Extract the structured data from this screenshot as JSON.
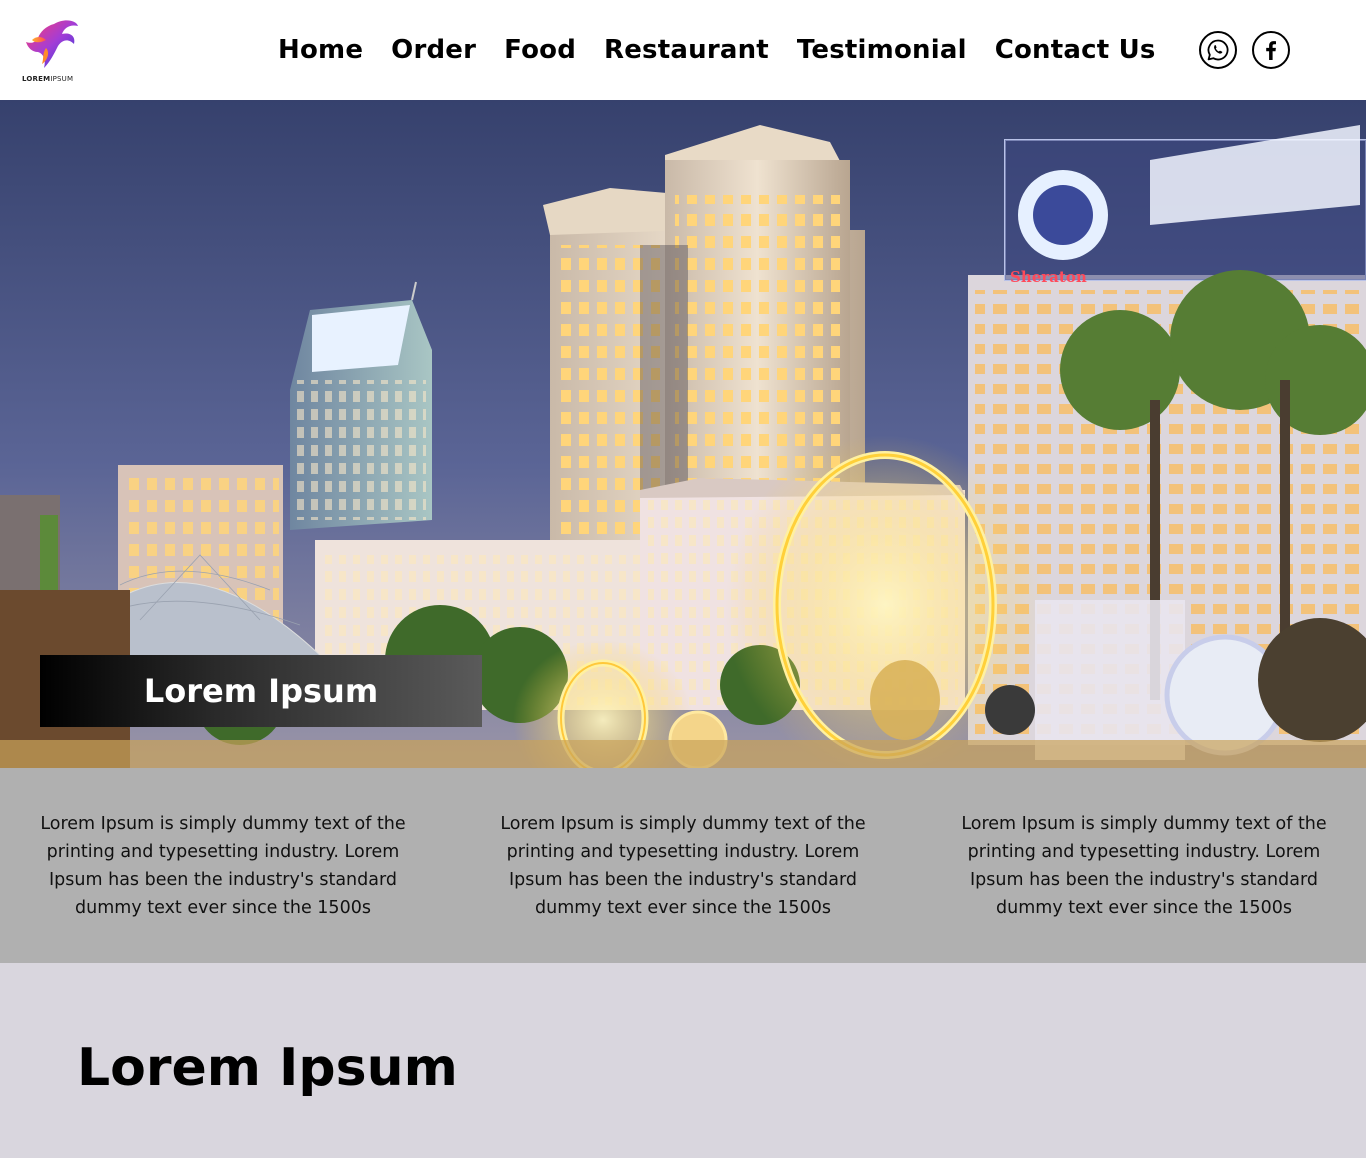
{
  "brand": {
    "logo_text_bold": "LOREM",
    "logo_text_light": "IPSUM"
  },
  "nav": [
    {
      "label": "Home"
    },
    {
      "label": "Order"
    },
    {
      "label": "Food"
    },
    {
      "label": "Restaurant"
    },
    {
      "label": "Testimonial"
    },
    {
      "label": "Contact Us"
    }
  ],
  "social": [
    {
      "icon": "whatsapp-icon"
    },
    {
      "icon": "facebook-icon"
    }
  ],
  "hero": {
    "label": "Lorem Ipsum",
    "sign_text": "Sheraton"
  },
  "features": [
    {
      "text": "Lorem Ipsum is simply dummy text of the printing and typesetting industry. Lorem Ipsum has been the industry's standard dummy text ever since the 1500s"
    },
    {
      "text": "Lorem Ipsum is simply dummy text of the printing and typesetting industry. Lorem Ipsum has been the industry's standard dummy text ever since the 1500s"
    },
    {
      "text": "Lorem Ipsum is simply dummy text of the printing and typesetting industry. Lorem Ipsum has been the industry's standard dummy text ever since the 1500s"
    }
  ],
  "section": {
    "title": "Lorem Ipsum"
  },
  "colors": {
    "header_bg": "#ffffff",
    "features_bg": "#b0b0b0",
    "section_bg": "#d9d6de",
    "label_gradient_start": "#000000",
    "label_gradient_end": "#5a5a5a"
  }
}
